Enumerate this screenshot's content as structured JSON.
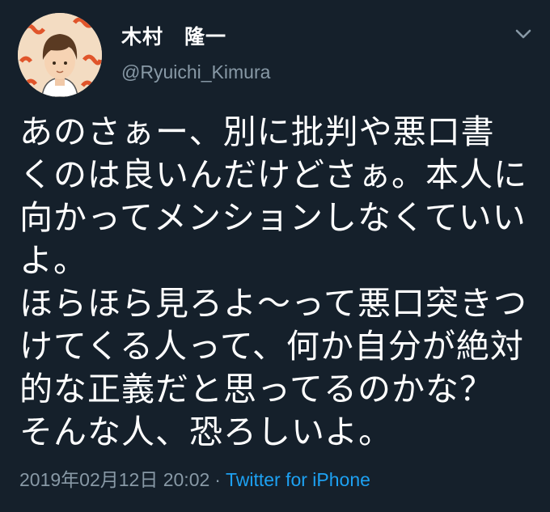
{
  "tweet": {
    "display_name": "木村　隆一",
    "handle": "@Ryuichi_Kimura",
    "menu_icon": "chevron-down-icon",
    "avatar_icon": "profile-avatar",
    "body_lines": [
      "あのさぁー、別に批判や悪口書",
      "くのは良いんだけどさぁ。本人に",
      "向かってメンションしなくていい",
      "よ。",
      "ほらほら見ろよ〜って悪口突きつ",
      "けてくる人って、何か自分が絶対",
      "的な正義だと思ってるのかな？",
      "そんな人、恐ろしいよ。"
    ],
    "timestamp": "2019年02月12日 20:02",
    "separator": "·",
    "source": "Twitter for iPhone"
  },
  "colors": {
    "background": "#15202b",
    "text": "#ffffff",
    "muted": "#8899a6",
    "link": "#1da1f2"
  }
}
